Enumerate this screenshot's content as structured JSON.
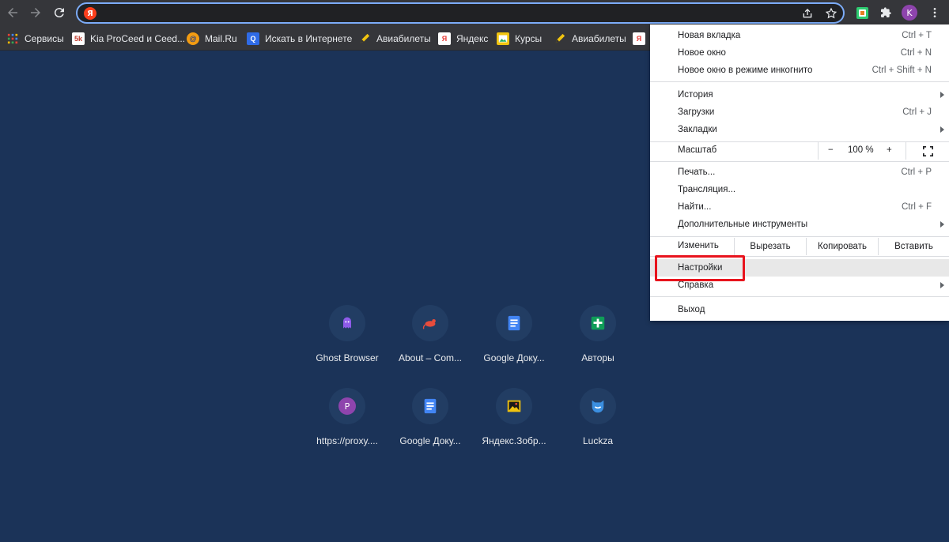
{
  "browser": {
    "address_value": "",
    "profile_initial": "K"
  },
  "bookmarks": [
    {
      "label": "Сервисы",
      "icon": "apps-grid-icon"
    },
    {
      "label": "Kia ProCeed и Ceed...",
      "icon": "5k-icon",
      "icon_text": "5k"
    },
    {
      "label": "Mail.Ru",
      "icon": "mailru-icon",
      "icon_text": "@"
    },
    {
      "label": "Искать в Интернете",
      "icon": "search-icon",
      "icon_text": "Q"
    },
    {
      "label": "Авиабилеты",
      "icon": "pen-icon"
    },
    {
      "label": "Яндекс",
      "icon": "yandex-icon",
      "icon_text": "Я"
    },
    {
      "label": "Курсы",
      "icon": "picture-icon"
    },
    {
      "label": "Авиабилеты",
      "icon": "pen-icon"
    },
    {
      "label": "",
      "icon": "yandex-icon",
      "icon_text": "Я"
    }
  ],
  "shortcuts": [
    {
      "label": "Ghost Browser",
      "icon": "ghost-icon"
    },
    {
      "label": "About – Com...",
      "icon": "mouse-icon"
    },
    {
      "label": "Google Доку...",
      "icon": "docs-icon"
    },
    {
      "label": "Авторы",
      "icon": "sheets-icon"
    },
    {
      "label": "https://proxy....",
      "icon": "proxy-icon",
      "icon_text": "P"
    },
    {
      "label": "Google Доку...",
      "icon": "docs-icon"
    },
    {
      "label": "Яндекс.Зобр...",
      "icon": "image-icon"
    },
    {
      "label": "Luckza",
      "icon": "luckza-icon"
    }
  ],
  "menu": {
    "new_tab": {
      "label": "Новая вкладка",
      "shortcut": "Ctrl + T"
    },
    "new_window": {
      "label": "Новое окно",
      "shortcut": "Ctrl + N"
    },
    "incognito": {
      "label": "Новое окно в режиме инкогнито",
      "shortcut": "Ctrl + Shift + N"
    },
    "history": {
      "label": "История"
    },
    "downloads": {
      "label": "Загрузки",
      "shortcut": "Ctrl + J"
    },
    "bookmarks": {
      "label": "Закладки"
    },
    "zoom": {
      "label": "Масштаб",
      "minus": "−",
      "value": "100 %",
      "plus": "+"
    },
    "print": {
      "label": "Печать...",
      "shortcut": "Ctrl + P"
    },
    "cast": {
      "label": "Трансляция..."
    },
    "find": {
      "label": "Найти...",
      "shortcut": "Ctrl + F"
    },
    "more_tools": {
      "label": "Дополнительные инструменты"
    },
    "edit": {
      "label": "Изменить",
      "cut": "Вырезать",
      "copy": "Копировать",
      "paste": "Вставить"
    },
    "settings": {
      "label": "Настройки"
    },
    "help": {
      "label": "Справка"
    },
    "exit": {
      "label": "Выход"
    }
  },
  "colors": {
    "page_bg": "#1b3358",
    "toolbar_bg": "#35363a",
    "highlight_box": "#e8141d"
  }
}
